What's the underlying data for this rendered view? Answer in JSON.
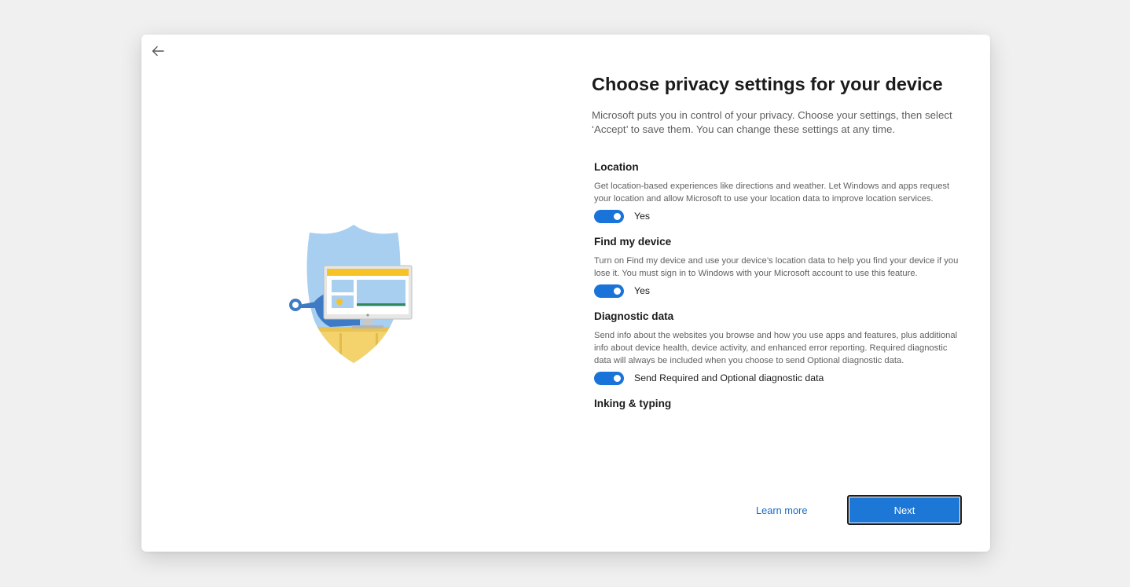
{
  "header": {
    "title": "Choose privacy settings for your device",
    "subtitle": "Microsoft puts you in control of your privacy. Choose your settings, then select ‘Accept’ to save them. You can change these settings at any time."
  },
  "back_button": {
    "icon": "arrow-left-icon"
  },
  "illustration": {
    "icon": "privacy-shield-icon"
  },
  "settings": [
    {
      "title": "Location",
      "description": "Get location-based experiences like directions and weather. Let Windows and apps request your location and allow Microsoft to use your location data to improve location services.",
      "toggle_on": true,
      "toggle_label": "Yes"
    },
    {
      "title": "Find my device",
      "description": "Turn on Find my device and use your device’s location data to help you find your device if you lose it. You must sign in to Windows with your Microsoft account to use this feature.",
      "toggle_on": true,
      "toggle_label": "Yes"
    },
    {
      "title": "Diagnostic data",
      "description": "Send info about the websites you browse and how you use apps and features, plus additional info about device health, device activity, and enhanced error reporting. Required diagnostic data will always be included when you choose to send Optional diagnostic data.",
      "toggle_on": true,
      "toggle_label": "Send Required and Optional diagnostic data"
    },
    {
      "title": "Inking & typing"
    }
  ],
  "footer": {
    "learn_more_label": "Learn more",
    "next_label": "Next"
  },
  "colors": {
    "accent": "#1a73d8",
    "button": "#1d77d6",
    "link": "#1a6cc4",
    "background": "#f0f0f0",
    "card": "#ffffff"
  }
}
